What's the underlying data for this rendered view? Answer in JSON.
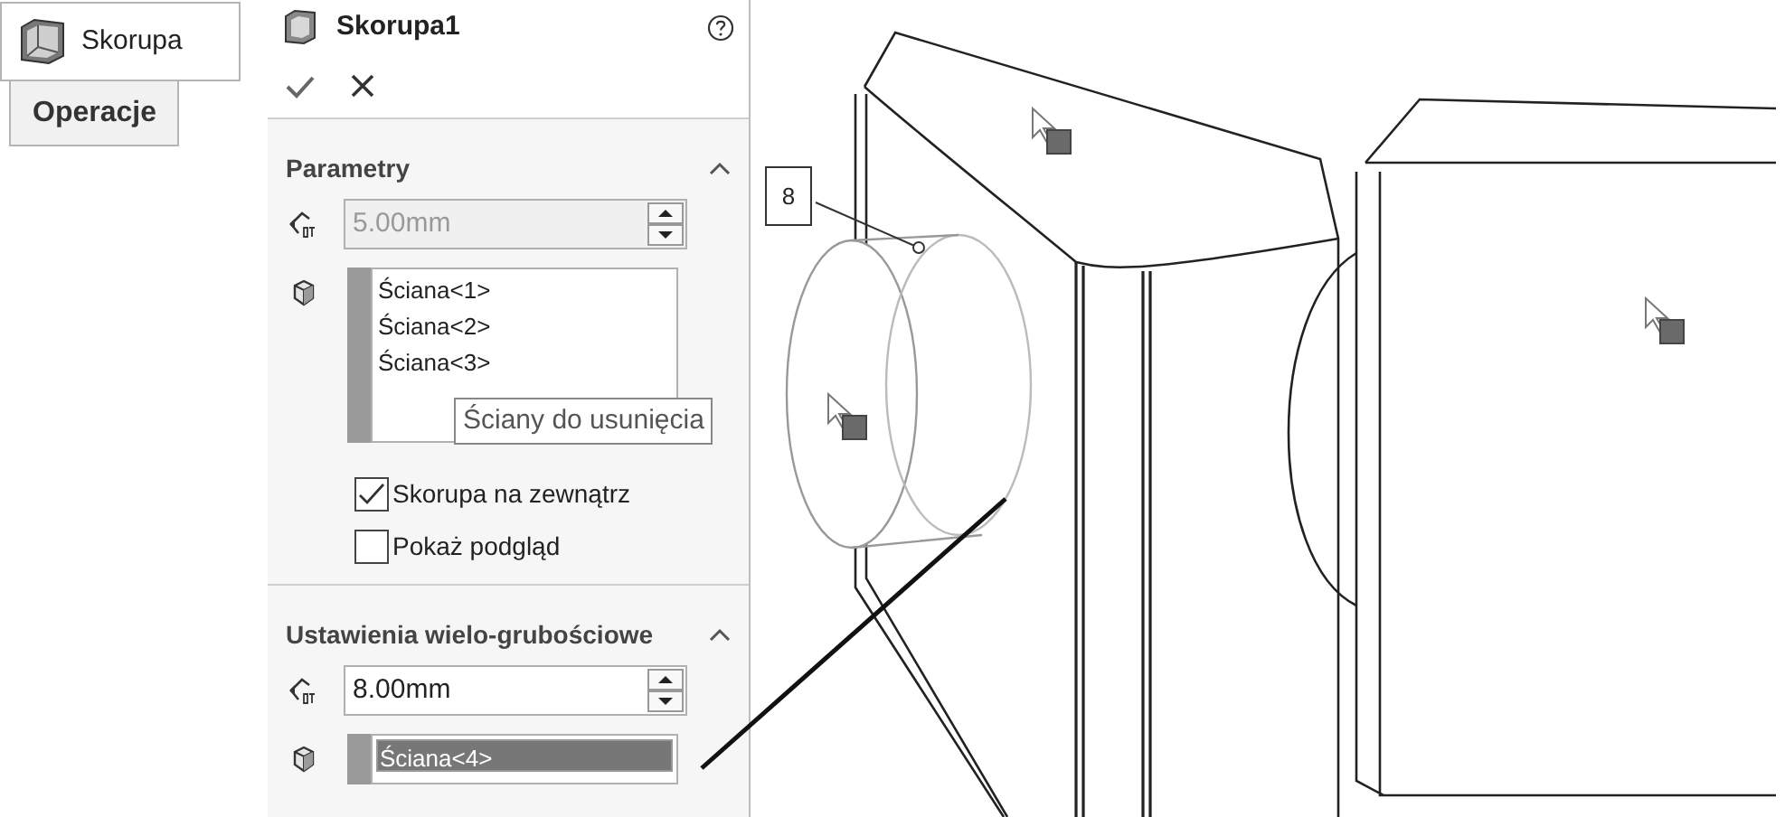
{
  "command": {
    "label": "Skorupa"
  },
  "tab": {
    "label": "Operacje",
    "selected": true
  },
  "panel": {
    "title": "Skorupa1"
  },
  "sections": [
    {
      "title": "Parametry",
      "expanded": true,
      "thickness": {
        "value": "5.00mm",
        "disabled": true
      },
      "faces": [
        {
          "label": "Ściana<1>",
          "selected": false
        },
        {
          "label": "Ściana<2>",
          "selected": false
        },
        {
          "label": "Ściana<3>",
          "selected": false
        }
      ],
      "tooltip": "Ściany do usunięcia",
      "options": [
        {
          "label": "Skorupa na zewnątrz",
          "checked": true
        },
        {
          "label": "Pokaż podgląd",
          "checked": false
        }
      ]
    },
    {
      "title": "Ustawienia wielo-grubościowe",
      "expanded": true,
      "thickness": {
        "value": "8.00mm",
        "disabled": false
      },
      "faces": [
        {
          "label": "Ściana<4>",
          "selected": true
        }
      ]
    }
  ],
  "viewport": {
    "callout": "8"
  }
}
